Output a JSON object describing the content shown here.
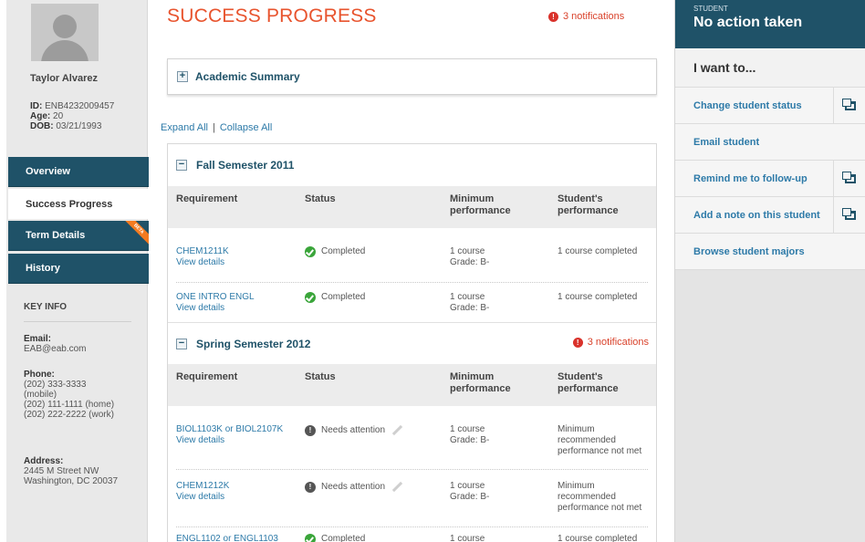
{
  "student": {
    "name": "Taylor Alvarez",
    "id_label": "ID:",
    "id_value": "ENB4232009457",
    "age_label": "Age:",
    "age_value": "20",
    "dob_label": "DOB:",
    "dob_value": "03/21/1993"
  },
  "nav": {
    "overview": "Overview",
    "success_progress": "Success Progress",
    "term_details": "Term Details",
    "beta": "BETA",
    "history": "History"
  },
  "key_info": {
    "title": "KEY INFO",
    "email_label": "Email:",
    "email": "EAB@eab.com",
    "phone_label": "Phone:",
    "phones": [
      "(202) 333-3333",
      "(mobile)",
      "(202) 111-1111 (home)",
      "(202) 222-2222 (work)"
    ],
    "address_label": "Address:",
    "address": [
      "2445 M Street NW",
      "Washington, DC 20037"
    ]
  },
  "main": {
    "title": "SUCCESS PROGRESS",
    "notifications": "3 notifications",
    "academic_summary": "Academic Summary",
    "expand_all": "Expand All",
    "separator": "|",
    "collapse_all": "Collapse All",
    "columns": {
      "requirement": "Requirement",
      "status": "Status",
      "min_perf": [
        "Minimum",
        "performance"
      ],
      "stud_perf": [
        "Student's",
        "performance"
      ]
    },
    "view_details": "View details",
    "semesters": [
      {
        "title": "Fall Semester 2011",
        "notifications": "",
        "rows": [
          {
            "req": "CHEM1211K",
            "status": "Completed",
            "status_type": "ok",
            "min": [
              "1 course",
              "Grade: B-"
            ],
            "stud": [
              "1 course completed"
            ]
          },
          {
            "req": "ONE INTRO ENGL",
            "status": "Completed",
            "status_type": "ok",
            "min": [
              "1 course",
              "Grade: B-"
            ],
            "stud": [
              "1 course completed"
            ]
          }
        ]
      },
      {
        "title": "Spring Semester 2012",
        "notifications": "3 notifications",
        "rows": [
          {
            "req": "BIOL1103K or BIOL2107K",
            "status": "Needs attention",
            "status_type": "warn",
            "min": [
              "1 course",
              "Grade: B-"
            ],
            "stud": [
              "Minimum",
              "recommended",
              "performance not met"
            ]
          },
          {
            "req": "CHEM1212K",
            "status": "Needs attention",
            "status_type": "warn",
            "min": [
              "1 course",
              "Grade: B-"
            ],
            "stud": [
              "Minimum",
              "recommended",
              "performance not met"
            ]
          },
          {
            "req": "ENGL1102 or ENGL1103",
            "status": "Completed",
            "status_type": "ok",
            "min": [
              "1 course"
            ],
            "stud": [
              "1 course completed"
            ]
          }
        ]
      }
    ]
  },
  "actions": {
    "status_label": "STUDENT",
    "status_value": "No action taken",
    "want": "I want to...",
    "items": [
      "Change student status",
      "Email student",
      "Remind me to follow-up",
      "Add a note on this student",
      "Browse student majors"
    ]
  },
  "colors": {
    "accent": "#e8542e",
    "nav_dark": "#1f5268",
    "link": "#2d7aa8",
    "alert": "#d9422b",
    "ok": "#3aa53a"
  }
}
